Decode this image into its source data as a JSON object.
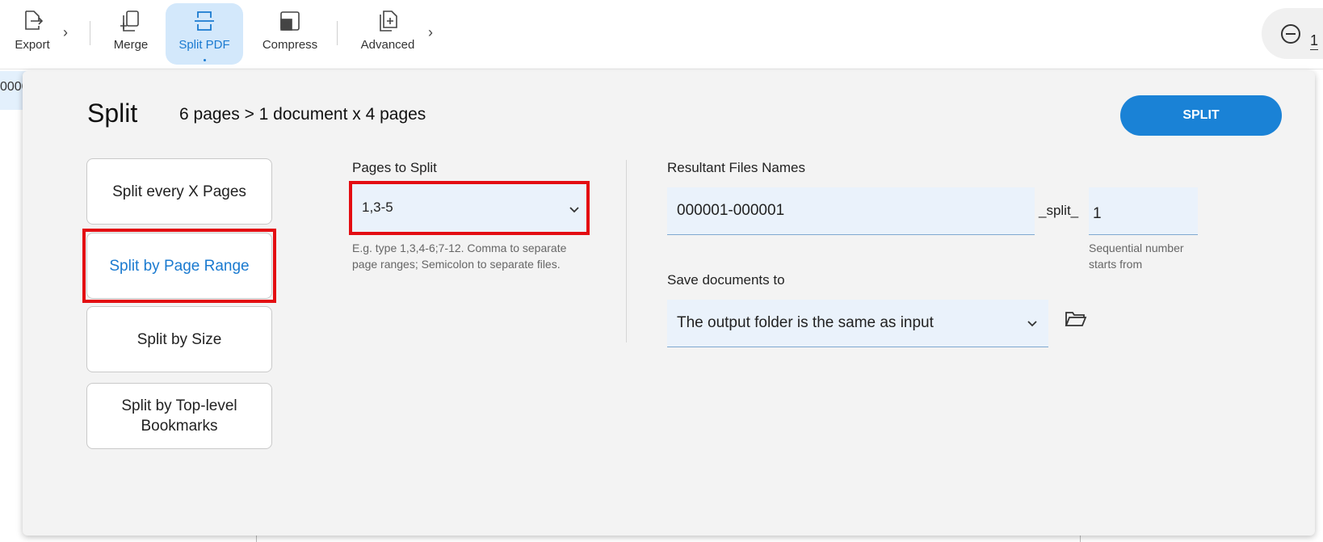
{
  "toolbar": {
    "items": [
      {
        "label": "Export",
        "icon": "export-icon"
      },
      {
        "label": "Merge",
        "icon": "merge-icon"
      },
      {
        "label": "Split PDF",
        "icon": "split-pdf-icon"
      },
      {
        "label": "Compress",
        "icon": "compress-icon"
      },
      {
        "label": "Advanced",
        "icon": "advanced-icon"
      }
    ],
    "active_item": "Split PDF",
    "chevron": "›",
    "zoom_value": "1"
  },
  "background": {
    "partial_text": "0000"
  },
  "panel": {
    "title": "Split",
    "summary": "6 pages > 1 document x 4 pages",
    "split_button": "SPLIT",
    "modes": [
      {
        "label": "Split every X Pages"
      },
      {
        "label": "Split by Page Range"
      },
      {
        "label": "Split by Size"
      },
      {
        "label": "Split by Top-level Bookmarks"
      }
    ],
    "active_mode": "Split by Page Range",
    "pages_to_split": {
      "label": "Pages to Split",
      "value": "1,3-5",
      "hint_line1": "E.g. type 1,3,4-6;7-12. Comma to separate",
      "hint_line2": "page ranges; Semicolon to separate files."
    },
    "resultant": {
      "label": "Resultant Files Names",
      "name_value": "000001-000001",
      "separator": "_split_",
      "seq_value": "1",
      "seq_hint_line1": "Sequential number",
      "seq_hint_line2": "starts from"
    },
    "save_to": {
      "label": "Save documents to",
      "value": "The output folder is the same as input"
    },
    "colors": {
      "accent": "#1a82d6",
      "highlight": "#e30d12",
      "panel_bg": "#f3f3f3"
    }
  }
}
